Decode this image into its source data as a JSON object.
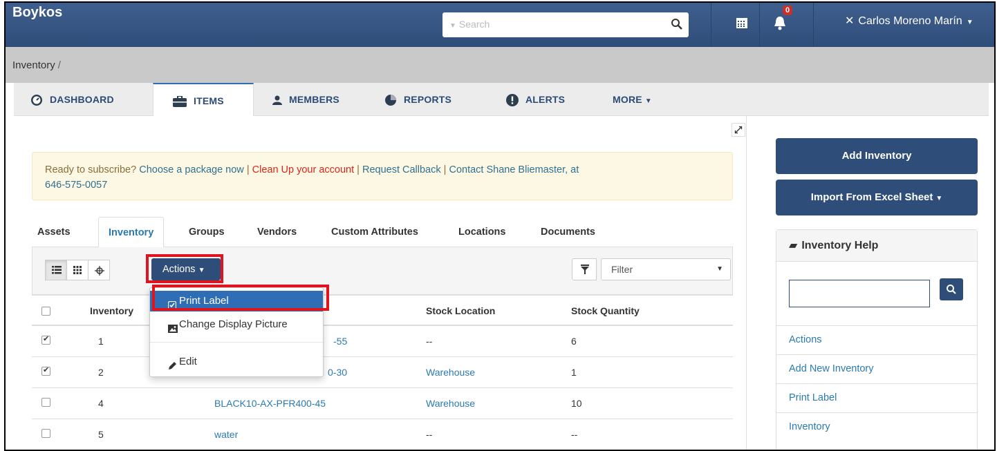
{
  "app": {
    "brand": "Boykos"
  },
  "search": {
    "placeholder": "Search"
  },
  "notifications": {
    "count": "0"
  },
  "user": {
    "name": "Carlos Moreno Marín"
  },
  "breadcrumb": {
    "item": "Inventory",
    "separator": "/"
  },
  "main_tabs": [
    {
      "label": "DASHBOARD",
      "icon": "dashboard-icon"
    },
    {
      "label": "ITEMS",
      "icon": "briefcase-icon"
    },
    {
      "label": "MEMBERS",
      "icon": "user-icon"
    },
    {
      "label": "REPORTS",
      "icon": "pie-chart-icon"
    },
    {
      "label": "ALERTS",
      "icon": "exclamation-icon"
    },
    {
      "label": "MORE",
      "icon": "caret-down-icon"
    }
  ],
  "alert": {
    "prefix": "Ready to subscribe?",
    "choose_package": "Choose a package now",
    "sep1": "|",
    "clean_up": "Clean Up your account",
    "sep2": "|",
    "request_callback": "Request Callback",
    "sep3": "|",
    "contact": "Contact Shane Bliemaster, at",
    "phone": "646-575-0057"
  },
  "sub_tabs": [
    "Assets",
    "Inventory",
    "Groups",
    "Vendors",
    "Custom Attributes",
    "Locations",
    "Documents"
  ],
  "toolbar": {
    "actions_label": "Actions",
    "filter_label": "Filter"
  },
  "actions_menu": {
    "items": [
      {
        "label": "Print Label",
        "icon": "check-square-icon"
      },
      {
        "label": "Change Display Picture",
        "icon": "picture-icon"
      },
      {
        "label": "Edit",
        "icon": "pencil-icon"
      }
    ]
  },
  "table": {
    "headers": {
      "inventory": "Inventory",
      "stock_location": "Stock Location",
      "stock_quantity": "Stock Quantity"
    },
    "rows": [
      {
        "id": "1",
        "name_suffix": "-55",
        "location": "--",
        "quantity": "6",
        "checked": true
      },
      {
        "id": "2",
        "name_suffix": "0-30",
        "location": "Warehouse",
        "quantity": "1",
        "checked": true
      },
      {
        "id": "4",
        "name": "BLACK10-AX-PFR400-45",
        "location": "Warehouse",
        "quantity": "10",
        "checked": false
      },
      {
        "id": "5",
        "name": "water",
        "location": "--",
        "quantity": "--",
        "checked": false
      }
    ]
  },
  "right_panel": {
    "add_inventory": "Add Inventory",
    "import_excel": "Import From Excel Sheet",
    "help_title": "Inventory Help",
    "help_links": [
      "Actions",
      "Add New Inventory",
      "Print Label",
      "Inventory"
    ]
  },
  "colors": {
    "navbar": "#2f4d79",
    "highlight": "#e0141e",
    "link": "#2a7ab0",
    "alert_bg": "#fcf8e3",
    "menu_active": "#2f6db5"
  }
}
